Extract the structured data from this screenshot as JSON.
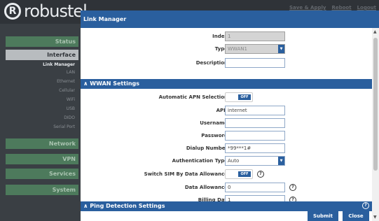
{
  "app": {
    "logo_text": "robustel",
    "top_links": [
      "Save & Apply",
      "Reboot",
      "Logout"
    ]
  },
  "sidebar": {
    "items": [
      {
        "label": "Status",
        "active": false
      },
      {
        "label": "Interface",
        "active": true
      },
      {
        "label": "Network",
        "active": false
      },
      {
        "label": "VPN",
        "active": false
      },
      {
        "label": "Services",
        "active": false
      },
      {
        "label": "System",
        "active": false
      }
    ],
    "sub_items": [
      "Link Manager",
      "LAN",
      "Ethernet",
      "Cellular",
      "WiFi",
      "USB",
      "DIDO",
      "Serial Port"
    ]
  },
  "modal": {
    "title": "Link Manager",
    "fields": {
      "index": {
        "label": "Index",
        "value": "1"
      },
      "type": {
        "label": "Type",
        "value": "WWAN1"
      },
      "description": {
        "label": "Description",
        "value": ""
      }
    },
    "wwan_section": {
      "title": "∧ WWAN Settings",
      "auto_apn": {
        "label": "Automatic APN Selection",
        "toggle": "OFF"
      },
      "apn": {
        "label": "APN",
        "value": "internet"
      },
      "username": {
        "label": "Username",
        "value": ""
      },
      "password": {
        "label": "Password",
        "value": ""
      },
      "dialup": {
        "label": "Dialup Number",
        "value": "*99***1#"
      },
      "auth_type": {
        "label": "Authentication Type",
        "value": "Auto"
      },
      "switch_sim": {
        "label": "Switch SIM By Data Allowance",
        "toggle": "OFF"
      },
      "data_allowance": {
        "label": "Data Allowance",
        "value": "0"
      },
      "billing_day": {
        "label": "Billing Day",
        "value": "1"
      }
    },
    "ping_section": {
      "title": "∧ Ping Detection Settings"
    },
    "buttons": {
      "submit": "Submit",
      "close": "Close"
    }
  },
  "icons": {
    "select_arrow": "chevron-down-icon",
    "help": "question-circle-icon"
  },
  "colors": {
    "primary": "#2a5f9e",
    "nav_green": "#4d7a5c",
    "nav_active": "#b8bcbf"
  }
}
